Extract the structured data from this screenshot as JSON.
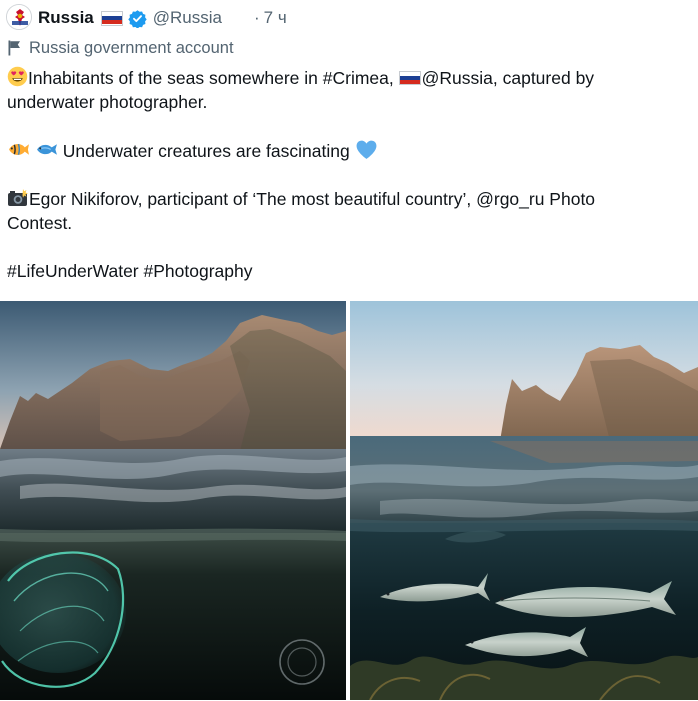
{
  "account": {
    "name": "Russia",
    "handle": "@Russia",
    "time": "7 ч",
    "separator": "·",
    "label": "Russia government account",
    "avatar_icon": "coat-of-arms-icon",
    "verified_color": "#1d9bf0"
  },
  "tweet": {
    "line1_part1": "Inhabitants of the seas somewhere in #Crimea, ",
    "line1_part2": "@Russia, captured by",
    "line2": "underwater photographer.",
    "line3": "Underwater creatures are fascinating",
    "line4": "Egor Nikiforov, participant of ‘The most beautiful country’, @rgo_ru Photo",
    "line5": "Contest.",
    "line6": "#LifeUnderWater #Photography"
  },
  "emojis": {
    "line1": "heart-eyes-emoji",
    "line3a": "tropical-fish-emoji",
    "line3b": "fish-emoji",
    "line3c": "blue-heart-emoji",
    "line4": "camera-flash-emoji"
  },
  "colors": {
    "text": "#0f1419",
    "secondary": "#536471",
    "flag_white": "#ffffff",
    "flag_blue": "#1c3f94",
    "flag_red": "#d52b1e"
  },
  "media": {
    "left": "split-view photo: rocky cliff above sea, comb jelly underwater",
    "right": "split-view photo: rocky cliff above sea, fish underwater"
  }
}
